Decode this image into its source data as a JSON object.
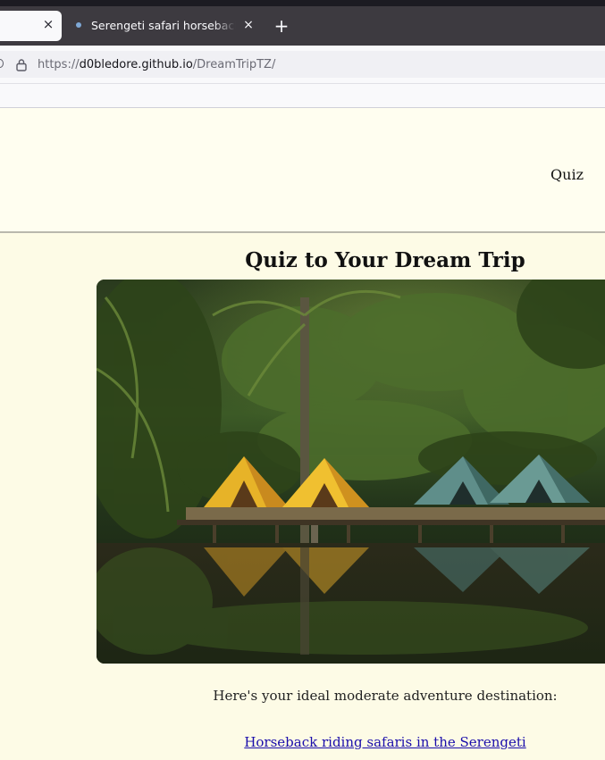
{
  "browser": {
    "tabs": [
      {
        "title": "",
        "active": true
      },
      {
        "title": "Serengeti safari horseback riding",
        "active": false
      }
    ],
    "url": {
      "scheme": "https://",
      "host": "d0bledore.github.io",
      "path": "/DreamTripTZ/"
    },
    "icons": {
      "tab_close": "×",
      "new_tab": "+"
    }
  },
  "site": {
    "nav": {
      "quiz_label": "Quiz"
    },
    "title": "Quiz to Your Dream Trip",
    "result_text": "Here's your ideal moderate adventure destination:",
    "result_link": "Horseback riding safaris in the Serengeti"
  },
  "colors": {
    "tab_bar": "#3d3a40",
    "page_background": "#fdfbe6",
    "link": "#1a0dab"
  }
}
